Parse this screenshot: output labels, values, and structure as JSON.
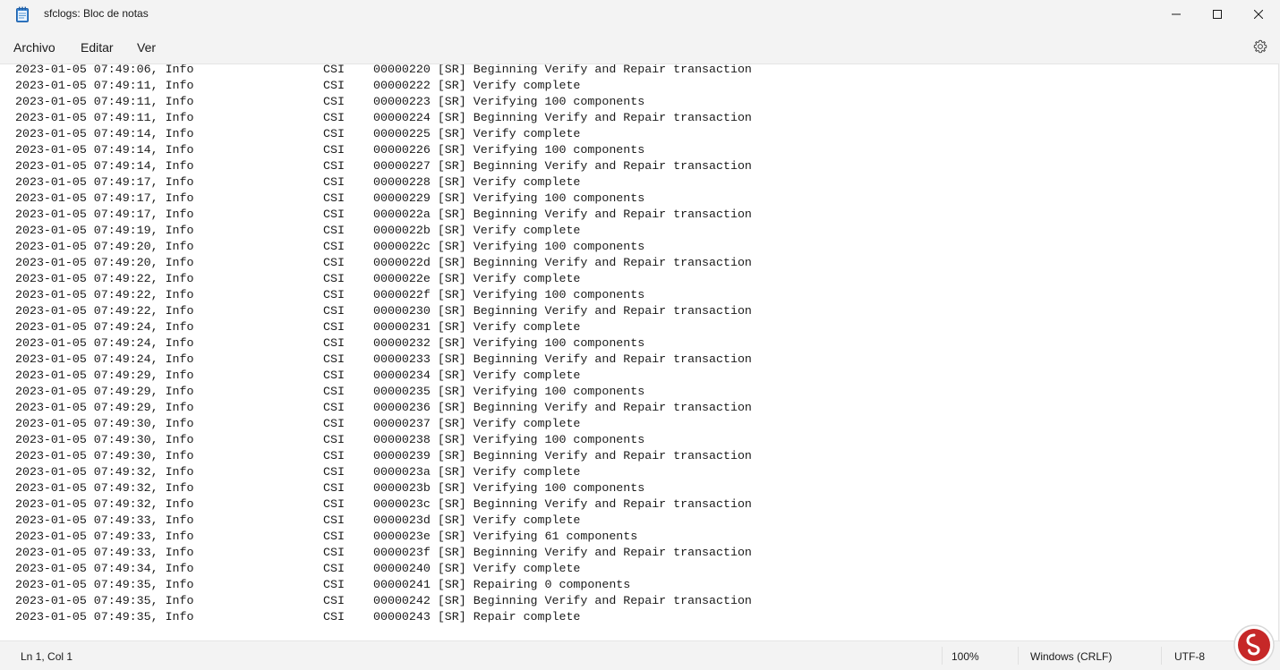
{
  "window": {
    "title": "sfclogs: Bloc de notas",
    "app_icon": "notepad-icon",
    "controls": [
      "minimize-icon",
      "maximize-icon",
      "close-icon"
    ]
  },
  "menu": {
    "items": [
      "Archivo",
      "Editar",
      "Ver"
    ],
    "settings_icon": "gear-icon"
  },
  "log_lines": [
    {
      "ts": "2023-01-05 07:49:06, Info",
      "src": "CSI",
      "msg": "00000220 [SR] Beginning Verify and Repair transaction"
    },
    {
      "ts": "2023-01-05 07:49:11, Info",
      "src": "CSI",
      "msg": "00000222 [SR] Verify complete"
    },
    {
      "ts": "2023-01-05 07:49:11, Info",
      "src": "CSI",
      "msg": "00000223 [SR] Verifying 100 components"
    },
    {
      "ts": "2023-01-05 07:49:11, Info",
      "src": "CSI",
      "msg": "00000224 [SR] Beginning Verify and Repair transaction"
    },
    {
      "ts": "2023-01-05 07:49:14, Info",
      "src": "CSI",
      "msg": "00000225 [SR] Verify complete"
    },
    {
      "ts": "2023-01-05 07:49:14, Info",
      "src": "CSI",
      "msg": "00000226 [SR] Verifying 100 components"
    },
    {
      "ts": "2023-01-05 07:49:14, Info",
      "src": "CSI",
      "msg": "00000227 [SR] Beginning Verify and Repair transaction"
    },
    {
      "ts": "2023-01-05 07:49:17, Info",
      "src": "CSI",
      "msg": "00000228 [SR] Verify complete"
    },
    {
      "ts": "2023-01-05 07:49:17, Info",
      "src": "CSI",
      "msg": "00000229 [SR] Verifying 100 components"
    },
    {
      "ts": "2023-01-05 07:49:17, Info",
      "src": "CSI",
      "msg": "0000022a [SR] Beginning Verify and Repair transaction"
    },
    {
      "ts": "2023-01-05 07:49:19, Info",
      "src": "CSI",
      "msg": "0000022b [SR] Verify complete"
    },
    {
      "ts": "2023-01-05 07:49:20, Info",
      "src": "CSI",
      "msg": "0000022c [SR] Verifying 100 components"
    },
    {
      "ts": "2023-01-05 07:49:20, Info",
      "src": "CSI",
      "msg": "0000022d [SR] Beginning Verify and Repair transaction"
    },
    {
      "ts": "2023-01-05 07:49:22, Info",
      "src": "CSI",
      "msg": "0000022e [SR] Verify complete"
    },
    {
      "ts": "2023-01-05 07:49:22, Info",
      "src": "CSI",
      "msg": "0000022f [SR] Verifying 100 components"
    },
    {
      "ts": "2023-01-05 07:49:22, Info",
      "src": "CSI",
      "msg": "00000230 [SR] Beginning Verify and Repair transaction"
    },
    {
      "ts": "2023-01-05 07:49:24, Info",
      "src": "CSI",
      "msg": "00000231 [SR] Verify complete"
    },
    {
      "ts": "2023-01-05 07:49:24, Info",
      "src": "CSI",
      "msg": "00000232 [SR] Verifying 100 components"
    },
    {
      "ts": "2023-01-05 07:49:24, Info",
      "src": "CSI",
      "msg": "00000233 [SR] Beginning Verify and Repair transaction"
    },
    {
      "ts": "2023-01-05 07:49:29, Info",
      "src": "CSI",
      "msg": "00000234 [SR] Verify complete"
    },
    {
      "ts": "2023-01-05 07:49:29, Info",
      "src": "CSI",
      "msg": "00000235 [SR] Verifying 100 components"
    },
    {
      "ts": "2023-01-05 07:49:29, Info",
      "src": "CSI",
      "msg": "00000236 [SR] Beginning Verify and Repair transaction"
    },
    {
      "ts": "2023-01-05 07:49:30, Info",
      "src": "CSI",
      "msg": "00000237 [SR] Verify complete"
    },
    {
      "ts": "2023-01-05 07:49:30, Info",
      "src": "CSI",
      "msg": "00000238 [SR] Verifying 100 components"
    },
    {
      "ts": "2023-01-05 07:49:30, Info",
      "src": "CSI",
      "msg": "00000239 [SR] Beginning Verify and Repair transaction"
    },
    {
      "ts": "2023-01-05 07:49:32, Info",
      "src": "CSI",
      "msg": "0000023a [SR] Verify complete"
    },
    {
      "ts": "2023-01-05 07:49:32, Info",
      "src": "CSI",
      "msg": "0000023b [SR] Verifying 100 components"
    },
    {
      "ts": "2023-01-05 07:49:32, Info",
      "src": "CSI",
      "msg": "0000023c [SR] Beginning Verify and Repair transaction"
    },
    {
      "ts": "2023-01-05 07:49:33, Info",
      "src": "CSI",
      "msg": "0000023d [SR] Verify complete"
    },
    {
      "ts": "2023-01-05 07:49:33, Info",
      "src": "CSI",
      "msg": "0000023e [SR] Verifying 61 components"
    },
    {
      "ts": "2023-01-05 07:49:33, Info",
      "src": "CSI",
      "msg": "0000023f [SR] Beginning Verify and Repair transaction"
    },
    {
      "ts": "2023-01-05 07:49:34, Info",
      "src": "CSI",
      "msg": "00000240 [SR] Verify complete"
    },
    {
      "ts": "2023-01-05 07:49:35, Info",
      "src": "CSI",
      "msg": "00000241 [SR] Repairing 0 components"
    },
    {
      "ts": "2023-01-05 07:49:35, Info",
      "src": "CSI",
      "msg": "00000242 [SR] Beginning Verify and Repair transaction"
    },
    {
      "ts": "2023-01-05 07:49:35, Info",
      "src": "CSI",
      "msg": "00000243 [SR] Repair complete"
    }
  ],
  "status": {
    "position": "Ln 1, Col 1",
    "zoom": "100%",
    "line_ending": "Windows (CRLF)",
    "encoding": "UTF-8"
  },
  "watermark_icon": "solvetic-logo-icon"
}
